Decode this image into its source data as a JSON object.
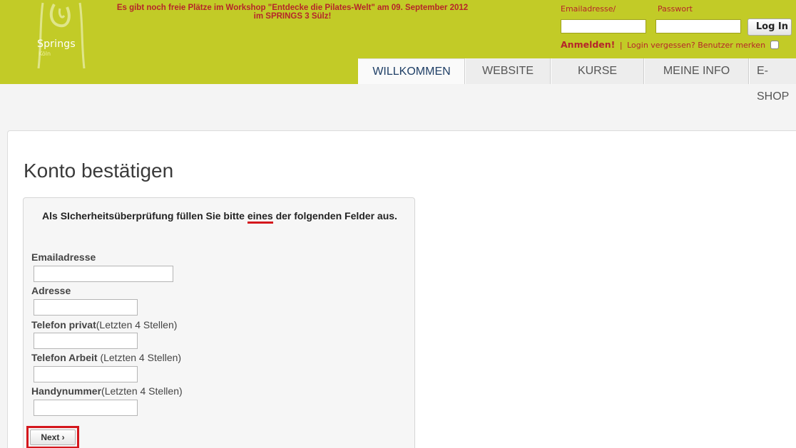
{
  "header": {
    "logo_text": "Springs",
    "logo_sub": "Köln",
    "announcement_line1": "Es gibt noch freie Plätze im Workshop \"Entdecke die Pilates-Welt\" am 09. September 2012",
    "announcement_line2": "im SPRINGS 3 Sülz!",
    "accent_color": "#c2cb27",
    "text_accent_color": "#b5252a"
  },
  "login": {
    "email_label": "Emailadresse/",
    "password_label": "Passwort",
    "email_value": "",
    "password_value": "",
    "login_button": "Log In",
    "anmelden": "Anmelden!",
    "separator": "|",
    "forgot": "Login vergessen?",
    "remember": "Benutzer merken"
  },
  "tabs": [
    {
      "label": "WILLKOMMEN",
      "active": true
    },
    {
      "label": "WEBSITE",
      "active": false
    },
    {
      "label": "KURSE",
      "active": false
    },
    {
      "label": "MEINE INFO",
      "active": false
    },
    {
      "label": "E-SHOP",
      "active": false
    }
  ],
  "main": {
    "title": "Konto bestätigen",
    "intro_part1": "Als SIcherheitsüberprüfung füllen Sie bitte ",
    "intro_underlined": "eines",
    "intro_part2": " der folgenden Felder aus.",
    "fields": [
      {
        "label": "Emailadresse",
        "hint": "",
        "value": ""
      },
      {
        "label": "Adresse",
        "hint": "",
        "value": ""
      },
      {
        "label": "Telefon privat",
        "hint": "(Letzten 4 Stellen)",
        "value": ""
      },
      {
        "label": "Telefon Arbeit",
        "hint": " (Letzten 4 Stellen)",
        "value": ""
      },
      {
        "label": "Handynummer",
        "hint": "(Letzten 4 Stellen)",
        "value": ""
      }
    ],
    "next_button": "Next ›",
    "highlight_color": "#d4171d"
  }
}
